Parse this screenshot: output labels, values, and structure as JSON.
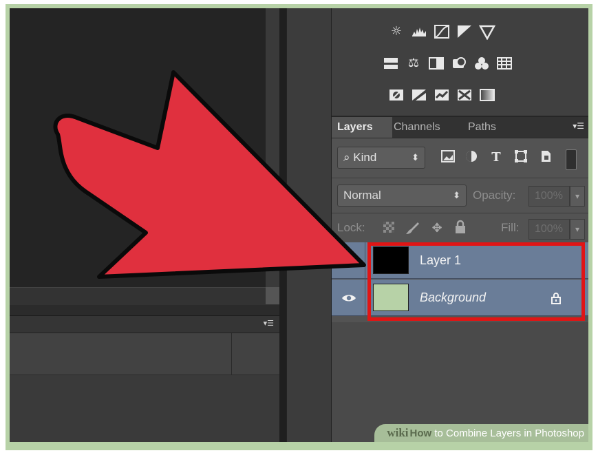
{
  "adjustments": {
    "icons_row1": [
      "brightness-contrast-icon",
      "levels-icon",
      "curves-icon",
      "exposure-icon",
      "vibrance-icon"
    ],
    "icons_row2": [
      "hue-saturation-icon",
      "color-balance-icon",
      "black-white-icon",
      "photo-filter-icon",
      "channel-mixer-icon",
      "color-lookup-icon"
    ],
    "icons_row3": [
      "invert-icon",
      "posterize-icon",
      "threshold-icon",
      "selective-color-icon",
      "gradient-map-icon"
    ]
  },
  "layers_panel": {
    "tabs": [
      {
        "label": "Layers",
        "active": true
      },
      {
        "label": "Channels",
        "active": false
      },
      {
        "label": "Paths",
        "active": false
      }
    ],
    "filter": {
      "label": "Kind",
      "icons": [
        "pixel-filter-icon",
        "adjustment-filter-icon",
        "type-filter-icon",
        "shape-filter-icon",
        "smart-object-filter-icon"
      ]
    },
    "blend_mode": "Normal",
    "opacity_label": "Opacity:",
    "opacity_value": "100%",
    "lock_label": "Lock:",
    "fill_label": "Fill:",
    "fill_value": "100%",
    "layers": [
      {
        "name": "Layer 1",
        "thumbnail_color": "#000000",
        "visible": true,
        "italic": false,
        "locked": false
      },
      {
        "name": "Background",
        "thumbnail_color": "#b7d2a7",
        "visible": true,
        "italic": true,
        "locked": true
      }
    ]
  },
  "annotation": {
    "arrow_color": "#e0303e",
    "highlight_color": "#e01515"
  },
  "watermark": {
    "brand": "wiki",
    "how": "How",
    "text": " to Combine Layers in Photoshop"
  }
}
